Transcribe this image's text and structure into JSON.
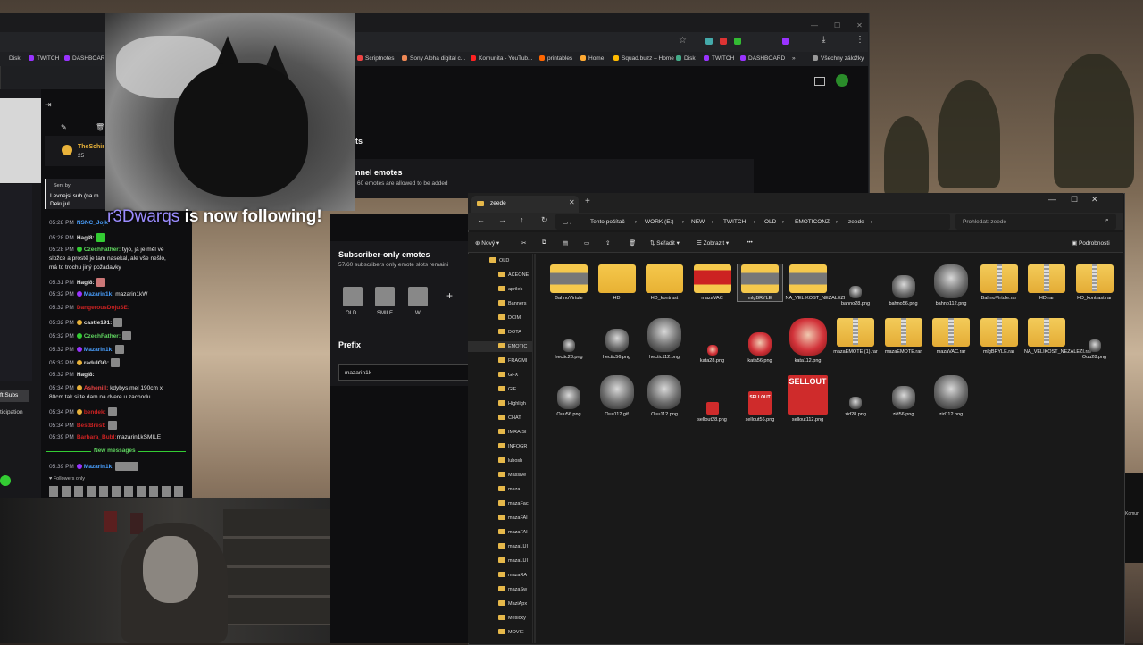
{
  "chrome": {
    "bookmarks": [
      "Disk",
      "TWITCH",
      "DASHBOARD",
      "Scriptnotes",
      "Sony Alpha digital c...",
      "Komunita - YouTub...",
      "printables",
      "Home",
      "Squad.buzz – Home",
      "Disk",
      "TWITCH",
      "DASHBOARD",
      "Všechny záložky"
    ],
    "more": "»"
  },
  "twitch_main": {
    "section_suffix": "ts",
    "channel_emotes_title": "nnel emotes",
    "channel_emotes_sub": "60 emotes are allowed to be added"
  },
  "chat": {
    "header_user": "TheSchir",
    "header_count": "25",
    "sub_header": "Sent by",
    "sub_msg1": "Levnejsi sub (na m",
    "sub_msg2": "Dekujul...",
    "lines": [
      {
        "time": "05:28 PM",
        "user": "NSNC_Jojk",
        "msg": ""
      },
      {
        "time": "05:28 PM",
        "user": "Hagl8:",
        "msg": ""
      },
      {
        "time": "05:28 PM",
        "user": "CzechFather:",
        "msg": "tyjo, já je měl ve"
      },
      {
        "time": "",
        "user": "",
        "msg": "složce a prostě je tam nasekal, ale vše nešlo,"
      },
      {
        "time": "",
        "user": "",
        "msg": "má to trochu jiný požadavky"
      },
      {
        "time": "05:31 PM",
        "user": "Hagl8:",
        "msg": ""
      },
      {
        "time": "05:32 PM",
        "user": "Mazarin1k:",
        "msg": "mazarin1kW"
      },
      {
        "time": "05:32 PM",
        "user": "DangerousDojuSE:",
        "msg": ""
      },
      {
        "time": "05:32 PM",
        "user": "castle191:",
        "msg": ""
      },
      {
        "time": "05:32 PM",
        "user": "CzechFather:",
        "msg": ""
      },
      {
        "time": "05:32 PM",
        "user": "Mazarin1k:",
        "msg": ""
      },
      {
        "time": "05:32 PM",
        "user": "radulGG:",
        "msg": ""
      },
      {
        "time": "05:32 PM",
        "user": "Hagl8:",
        "msg": ""
      },
      {
        "time": "05:34 PM",
        "user": "Ashenill:",
        "msg": "kdybys mel 190cm x"
      },
      {
        "time": "",
        "user": "",
        "msg": "80cm tak si te dam na dvere u zachodu"
      },
      {
        "time": "05:34 PM",
        "user": "bendek:",
        "msg": ""
      },
      {
        "time": "05:34 PM",
        "user": "BestBrest:",
        "msg": ""
      },
      {
        "time": "05:39 PM",
        "user": "Barbara_Bubl:",
        "msg": "mazarin1kSMILE"
      }
    ],
    "new_messages": "New messages",
    "last_time": "05:39 PM",
    "last_user": "Mazarin1k:",
    "followers_only": "Followers only",
    "left_labels": [
      "ft Subs",
      "ticipation"
    ]
  },
  "alert": {
    "user": "r3Dwarqs",
    "text": "is now following!"
  },
  "settings": {
    "sub_title": "Subscriber-only emotes",
    "sub_sub": "57/60 subscribers only emote slots remaini",
    "emotes": [
      "OLD",
      "SMILE",
      "W"
    ],
    "add": "+",
    "prefix_title": "Prefix",
    "prefix_value": "mazarin1k"
  },
  "explorer": {
    "tab": "zeede",
    "breadcrumb": [
      "Tento počítač",
      "WORK (E:)",
      "NEW",
      "TWITCH",
      "OLD",
      "EMOTICONZ",
      "zeede"
    ],
    "search_placeholder": "Prohledat: zeede",
    "cmd": {
      "new": "Nový",
      "sort": "Seřadit",
      "view": "Zobrazit",
      "more": "•••",
      "details": "Podrobnosti"
    },
    "sidebar": [
      "OLD",
      "ACEONE",
      "aprilek",
      "Banners",
      "DCIM",
      "DOTA",
      "EMOTIC",
      "FRAGMI",
      "GFX",
      "GIF",
      "Highligh",
      "CHAT",
      "IMRAISI",
      "INFOGR",
      "lubosh",
      "Massive",
      "maza",
      "mazaFac",
      "mazaFAI",
      "mazaFAI",
      "mazaLUI",
      "mazaLUI",
      "mazaRA",
      "mazaSw",
      "MaziApx",
      "Mesicky",
      "MOVIE"
    ],
    "row1": [
      {
        "name": "BahnoVirtule",
        "kind": "folderimg"
      },
      {
        "name": "HD",
        "kind": "folder"
      },
      {
        "name": "HD_kontrast",
        "kind": "folder"
      },
      {
        "name": "mazaVAC",
        "kind": "folderred"
      },
      {
        "name": "mlgBRYLE",
        "kind": "folderimg",
        "selected": true
      },
      {
        "name": "NA_VELIKOST_NEZALEZI",
        "kind": "folderimg"
      },
      {
        "name": "bahno28.png",
        "kind": "facesm"
      },
      {
        "name": "bahno56.png",
        "kind": "facemd"
      },
      {
        "name": "bahno112.png",
        "kind": "facelg"
      },
      {
        "name": "BahnoVirtule.rar",
        "kind": "rar"
      },
      {
        "name": "HD.rar",
        "kind": "rar"
      },
      {
        "name": "HD_kontrast.rar",
        "kind": "rar"
      }
    ],
    "row2": [
      {
        "name": "hectic28.png",
        "kind": "facesm"
      },
      {
        "name": "hectic56.png",
        "kind": "facemd"
      },
      {
        "name": "hectic112.png",
        "kind": "facelg"
      },
      {
        "name": "kata28.png",
        "kind": "redsm"
      },
      {
        "name": "kata56.png",
        "kind": "redmd"
      },
      {
        "name": "kata112.png",
        "kind": "redlg"
      },
      {
        "name": "mazaEMOTE (1).rar",
        "kind": "rar"
      },
      {
        "name": "mazaEMOTE.rar",
        "kind": "rar"
      },
      {
        "name": "mazaVAC.rar",
        "kind": "rar"
      },
      {
        "name": "mlgBRYLE.rar",
        "kind": "rar"
      },
      {
        "name": "NA_VELIKOST_NEZALEZI.rar",
        "kind": "rar"
      },
      {
        "name": "Ouu28.png",
        "kind": "facesm"
      }
    ],
    "row3": [
      {
        "name": "Ouu56.png",
        "kind": "facemd"
      },
      {
        "name": "Ouu112.gif",
        "kind": "facelg"
      },
      {
        "name": "Ouu112.png",
        "kind": "facelg"
      },
      {
        "name": "sellout28.png",
        "kind": "sellsm",
        "label": ""
      },
      {
        "name": "sellout56.png",
        "kind": "sellmd",
        "label": "SELLOUT"
      },
      {
        "name": "sellout112.png",
        "kind": "selllg",
        "label": "SELLOUT"
      },
      {
        "name": "zid28.png",
        "kind": "facesm"
      },
      {
        "name": "zid56.png",
        "kind": "facemd"
      },
      {
        "name": "zid112.png",
        "kind": "facelg"
      }
    ]
  },
  "right_edge": "Komun"
}
